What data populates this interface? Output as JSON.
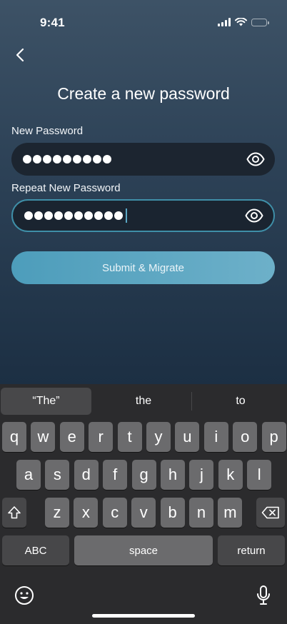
{
  "status": {
    "time": "9:41"
  },
  "nav": {
    "back_icon": "chevron-left-icon"
  },
  "page": {
    "title": "Create a new password"
  },
  "form": {
    "new_password": {
      "label": "New Password",
      "dot_count": 9,
      "eye_icon": "eye-icon"
    },
    "repeat_password": {
      "label": "Repeat New Password",
      "dot_count": 10,
      "eye_icon": "eye-icon"
    },
    "submit_label": "Submit & Migrate"
  },
  "keyboard": {
    "suggestions": [
      "“The”",
      "the",
      "to"
    ],
    "row1": [
      "q",
      "w",
      "e",
      "r",
      "t",
      "y",
      "u",
      "i",
      "o",
      "p"
    ],
    "row2": [
      "a",
      "s",
      "d",
      "f",
      "g",
      "h",
      "j",
      "k",
      "l"
    ],
    "row3": [
      "z",
      "x",
      "c",
      "v",
      "b",
      "n",
      "m"
    ],
    "abc_label": "ABC",
    "space_label": "space",
    "return_label": "return"
  },
  "colors": {
    "accent": "#4d9dbb",
    "field_bg": "#1c2530",
    "focus_border": "#3f8fa8"
  }
}
